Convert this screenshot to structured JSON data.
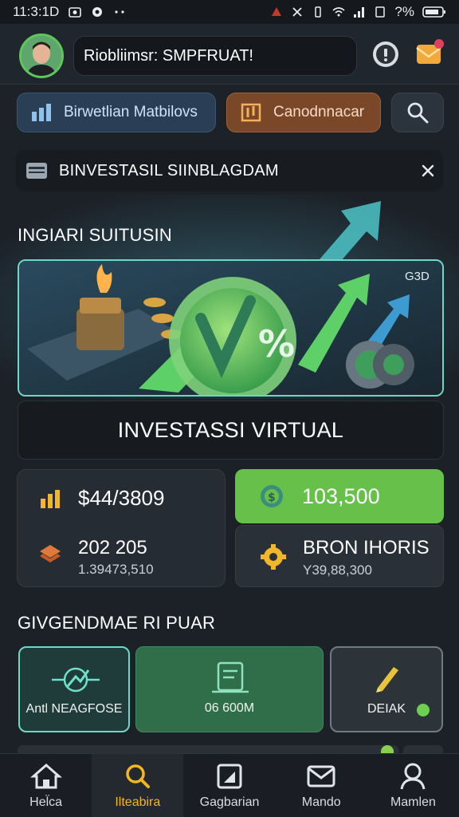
{
  "status_bar": {
    "time": "11:3:1D",
    "battery": "?%"
  },
  "header": {
    "title": "Riobliimsr: SMPFRUAT!"
  },
  "tabs": [
    {
      "label": "Birwetlian Matbilovs"
    },
    {
      "label": "Canodnnacar"
    }
  ],
  "notice": {
    "text": "BINVESTASIL SIINBLAGDAM"
  },
  "section_1": {
    "title": "INGIARI SUITUSIN"
  },
  "banner": {
    "badge": "G3D",
    "caption": "INVESTASSI VIRTUAL"
  },
  "stats": {
    "balance": "$44/3809",
    "secondary_value": "202 205",
    "secondary_sub": "1.39473,510",
    "green_value": "103,500",
    "bron_label": "BRON IHORIS",
    "bron_sub": "Y39,88,300"
  },
  "section_2": {
    "title": "GIVGENDMAE RI PUAR"
  },
  "tiles": [
    {
      "label": "Antl NEAGFOSE"
    },
    {
      "label": "06 600M"
    },
    {
      "label": "DEIAK"
    }
  ],
  "bottom_nav": [
    {
      "label": "Hel̈ca"
    },
    {
      "label": "Ilteabira"
    },
    {
      "label": "Gagbarian"
    },
    {
      "label": "Mando"
    },
    {
      "label": "Mamlen"
    }
  ],
  "colors": {
    "accent_green": "#67c04a",
    "accent_teal": "#6fd8c5",
    "active_nav": "#f2b820"
  }
}
